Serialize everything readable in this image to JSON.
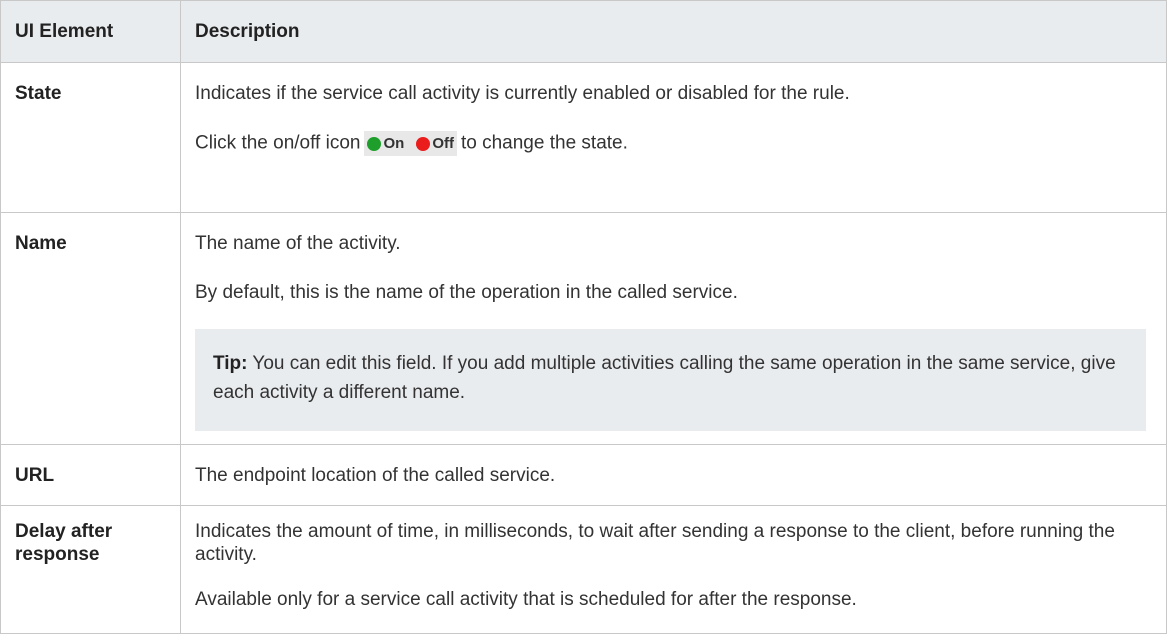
{
  "header": {
    "col1": "UI Element",
    "col2": "Description"
  },
  "rows": [
    {
      "element": "State",
      "p1": "Indicates if the service call activity is currently enabled or disabled for the rule.",
      "p2_before": "Click the on/off icon",
      "p2_after": "to change the state.",
      "on_label": "On",
      "off_label": "Off"
    },
    {
      "element": "Name",
      "p1": "The name of the activity.",
      "p2": "By default, this is the name of the operation in the called service.",
      "tip_label": "Tip:",
      "tip_text": "You can edit this field. If you add multiple activities calling the same operation in the same service, give each activity a different name."
    },
    {
      "element": "URL",
      "p1": "The endpoint location of the called service."
    },
    {
      "element": "Delay after response",
      "p1": "Indicates the amount of time, in milliseconds, to wait after sending a response to the client, before running the activity.",
      "p2": "Available only for a service call activity that is scheduled for after the response."
    }
  ],
  "colors": {
    "on_dot": "#1e9e2a",
    "off_dot": "#ea1c1c",
    "header_bg": "#e9ecef"
  },
  "icons": [
    "on-status-icon",
    "off-status-icon"
  ]
}
